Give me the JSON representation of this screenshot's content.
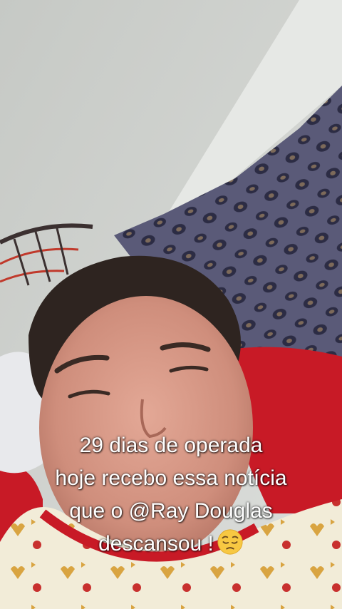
{
  "caption": {
    "lines": [
      "29 dias de operada",
      "hoje recebo essa notícia",
      "que o @Ray Douglas",
      "descansou !"
    ],
    "emoji": "pensive-face"
  },
  "colors": {
    "wall": "#d3d5d1",
    "blanket_pattern": "#3a3a55",
    "pillow_red": "#c81a26",
    "skin": "#d49584",
    "hair": "#2e2420",
    "caption_text": "#ffffff"
  }
}
